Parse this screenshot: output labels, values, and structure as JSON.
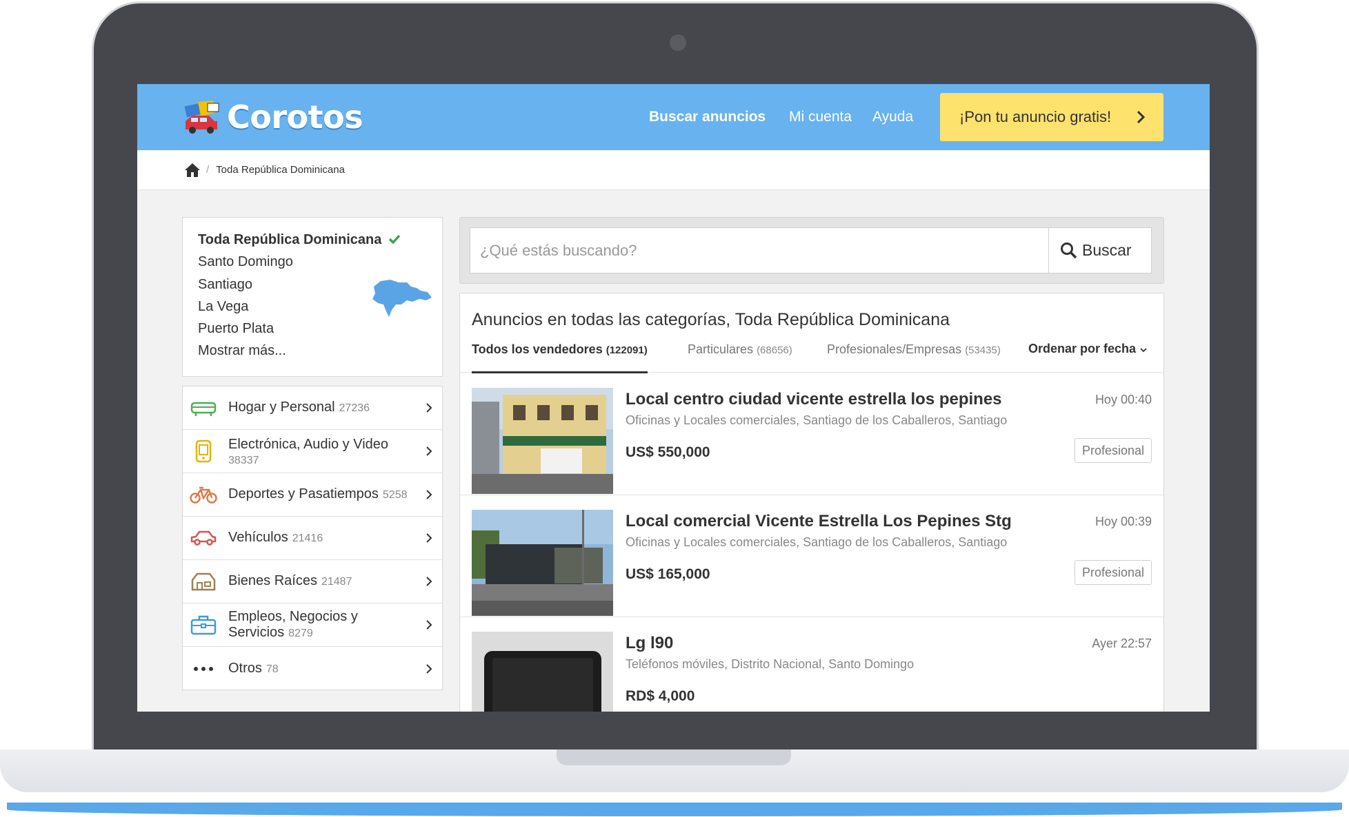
{
  "header": {
    "logo_text": "Corotos",
    "nav_search": "Buscar anuncios",
    "nav_account": "Mi cuenta",
    "nav_help": "Ayuda",
    "cta_label": "¡Pon tu anuncio gratis!"
  },
  "breadcrumb": {
    "home_icon": "home-icon",
    "current": "Toda República Dominicana"
  },
  "regions": {
    "active": "Toda República Dominicana",
    "items": [
      "Santo Domingo",
      "Santiago",
      "La Vega",
      "Puerto Plata",
      "Mostrar más..."
    ]
  },
  "categories": [
    {
      "label": "Hogar y Personal",
      "count": "27236",
      "icon": "sofa-icon",
      "color": "#4caf50"
    },
    {
      "label": "Electrónica, Audio y Video",
      "count": "38337",
      "icon": "phone-icon",
      "color": "#e0b400"
    },
    {
      "label": "Deportes y Pasatiempos",
      "count": "5258",
      "icon": "bicycle-icon",
      "color": "#e07a4a"
    },
    {
      "label": "Vehículos",
      "count": "21416",
      "icon": "car-icon",
      "color": "#d9534f"
    },
    {
      "label": "Bienes Raíces",
      "count": "21487",
      "icon": "house-icon",
      "color": "#a08050"
    },
    {
      "label": "Empleos, Negocios y Servicios",
      "count": "8279",
      "icon": "briefcase-icon",
      "color": "#3a9bd9"
    },
    {
      "label": "Otros",
      "count": "78",
      "icon": "more-icon",
      "color": "#333333"
    }
  ],
  "search": {
    "placeholder": "¿Qué estás buscando?",
    "button": "Buscar"
  },
  "results": {
    "title": "Anuncios en todas las categorías, Toda República Dominicana",
    "tabs": [
      {
        "label": "Todos los vendedores",
        "count": "(122091)"
      },
      {
        "label": "Particulares",
        "count": "(68656)"
      },
      {
        "label": "Profesionales/Empresas",
        "count": "(53435)"
      }
    ],
    "sort_label": "Ordenar por fecha",
    "listings": [
      {
        "title": "Local centro ciudad vicente estrella los pepines",
        "time": "Hoy 00:40",
        "subtitle": "Oficinas y Locales comerciales, Santiago de los Caballeros, Santiago",
        "price": "US$ 550,000",
        "badge": "Profesional"
      },
      {
        "title": "Local comercial Vicente Estrella Los Pepines Stg",
        "time": "Hoy 00:39",
        "subtitle": "Oficinas y Locales comerciales, Santiago de los Caballeros, Santiago",
        "price": "US$ 165,000",
        "badge": "Profesional"
      },
      {
        "title": "Lg l90",
        "time": "Ayer 22:57",
        "subtitle": "Teléfonos móviles, Distrito Nacional, Santo Domingo",
        "price": "RD$ 4,000",
        "badge": ""
      }
    ]
  },
  "colors": {
    "header_bg": "#67b2ef",
    "cta_bg": "#fde26e",
    "check": "#3aa55a"
  }
}
